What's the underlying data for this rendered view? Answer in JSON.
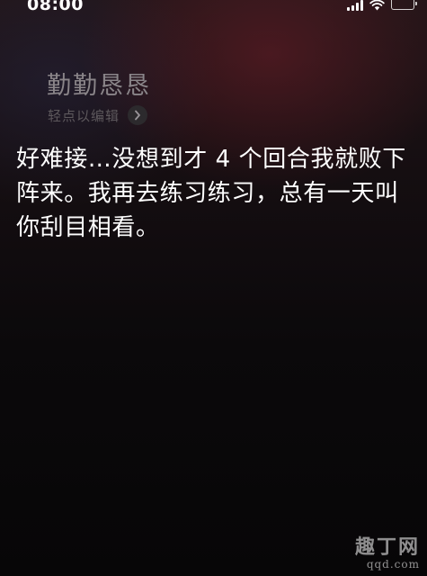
{
  "status_bar": {
    "time": "08:00"
  },
  "siri": {
    "query": "勤勤恳恳",
    "edit_hint": "轻点以编辑",
    "response": "好难接…没想到才 4 个回合我就败下阵来。我再去练习练习，总有一天叫你刮目相看。"
  },
  "watermark": {
    "top": "趣丁网",
    "bottom": "qqd.com"
  },
  "icons": {
    "signal": "cellular-signal-icon",
    "wifi": "wifi-icon",
    "battery": "battery-icon",
    "chevron": "chevron-right-icon"
  }
}
